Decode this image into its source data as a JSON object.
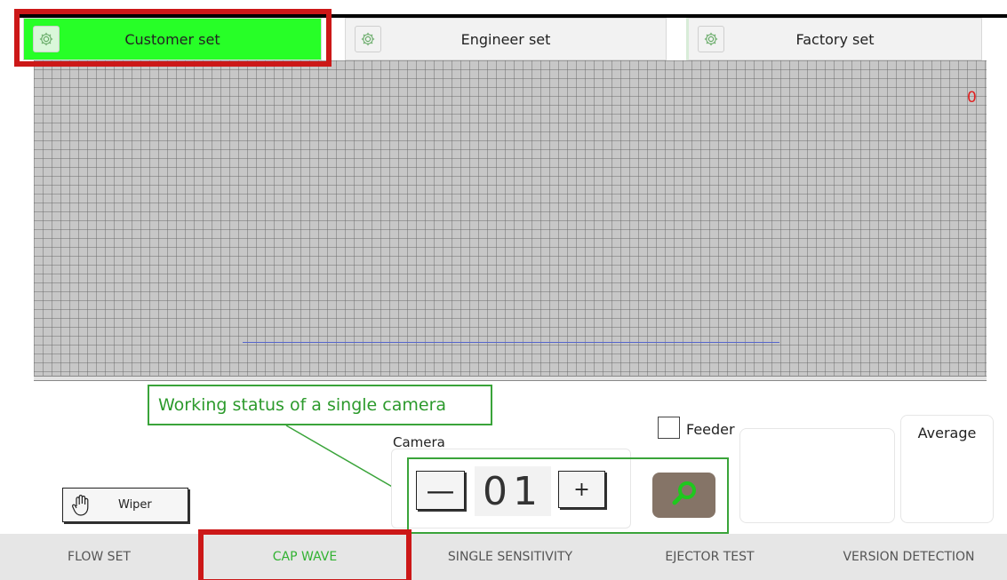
{
  "tabs": [
    {
      "label": "Customer set",
      "icon": "gear-icon",
      "active": true
    },
    {
      "label": "Engineer set",
      "icon": "gear-icon",
      "active": false
    },
    {
      "label": "Factory set",
      "icon": "gear-icon",
      "active": false
    }
  ],
  "graph": {
    "counter": "0",
    "colors": {
      "background": "#c7c7c7",
      "wave": "#5566cc",
      "counter": "#e02020"
    }
  },
  "annotation": {
    "label": "Working status of a single camera",
    "color": "#3aa43a",
    "highlight_color": "#cc1818"
  },
  "feeder": {
    "label": "Feeder",
    "checked": false
  },
  "camera": {
    "label": "Camera",
    "value": "01",
    "minus_symbol": "—",
    "plus_symbol": "+",
    "search_icon": "search-icon",
    "search_bg": "#857467"
  },
  "average": {
    "label": "Average"
  },
  "wiper": {
    "label": "Wiper",
    "icon": "hand-icon"
  },
  "nav": [
    {
      "label": "FLOW SET",
      "active": false
    },
    {
      "label": "CAP WAVE",
      "active": true
    },
    {
      "label": "SINGLE SENSITIVITY",
      "active": false
    },
    {
      "label": "EJECTOR TEST",
      "active": false
    },
    {
      "label": "VERSION DETECTION",
      "active": false
    }
  ],
  "accent_color": "#27ff27"
}
